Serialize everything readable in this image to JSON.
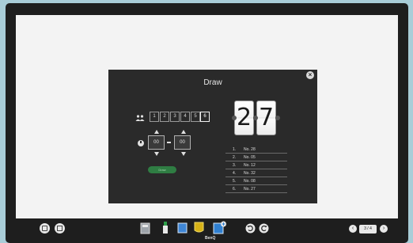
{
  "dialog": {
    "title": "Draw",
    "close_label": "×",
    "people_options": [
      "1",
      "2",
      "3",
      "4",
      "5",
      "6"
    ],
    "selected_people": "6",
    "range_from": "00",
    "range_to": "00",
    "draw_button": "Draw"
  },
  "counter": {
    "digit1": "2",
    "digit2": "7"
  },
  "results": [
    {
      "idx": "1.",
      "val": "No. 28"
    },
    {
      "idx": "2.",
      "val": "No. 05"
    },
    {
      "idx": "3.",
      "val": "No. 12"
    },
    {
      "idx": "4.",
      "val": "No. 32"
    },
    {
      "idx": "5.",
      "val": "No. 08"
    },
    {
      "idx": "6.",
      "val": "No. 27"
    }
  ],
  "taskbar": {
    "brand": "BenQ",
    "page_indicator": "3 / 4",
    "prev_label": "‹",
    "next_label": "›"
  },
  "icons": [
    "exit-icon",
    "save-icon",
    "eraser-icon",
    "marker-icon",
    "whiteboard-icon",
    "toolbox-icon",
    "add-page-icon",
    "undo-icon",
    "redo-icon",
    "prev-page-icon",
    "next-page-icon",
    "people-icon",
    "timer-icon",
    "close-icon"
  ]
}
